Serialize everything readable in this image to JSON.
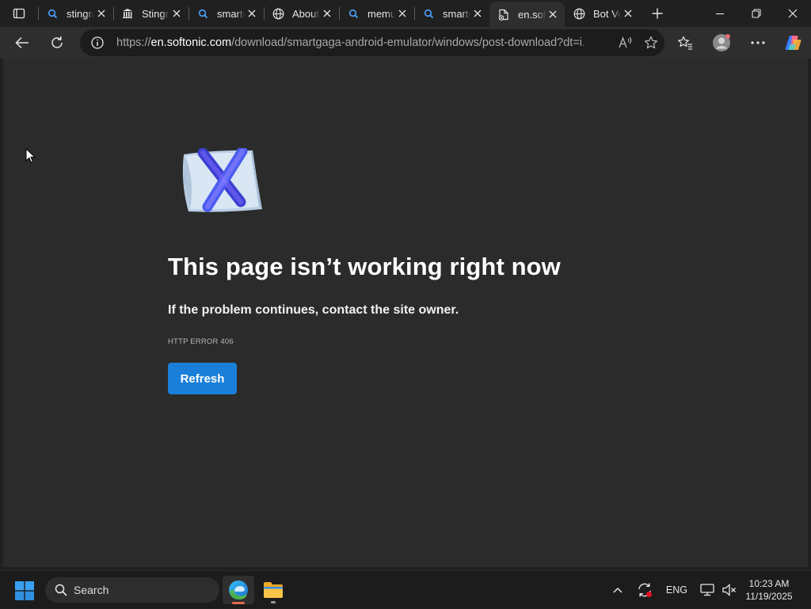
{
  "tabs": [
    {
      "label": "stingray",
      "icon": "search-icon",
      "active": false
    },
    {
      "label": "Stingray",
      "icon": "museum-icon",
      "active": false
    },
    {
      "label": "smartgaga",
      "icon": "search-icon",
      "active": false
    },
    {
      "label": "About",
      "icon": "globe-icon",
      "active": false
    },
    {
      "label": "memu",
      "icon": "search-icon",
      "active": false
    },
    {
      "label": "smartgaga",
      "icon": "search-icon",
      "active": false
    },
    {
      "label": "en.softonic",
      "icon": "broken-page-icon",
      "active": true
    },
    {
      "label": "Bot Verification",
      "icon": "globe-icon",
      "active": false
    }
  ],
  "address_bar": {
    "url_prefix": "https://",
    "host": "en.softonic.com",
    "path": "/download/smartgaga-android-emulator/windows/post-download?dt=i..."
  },
  "error_page": {
    "title": "This page isn’t working right now",
    "subtitle": "If the problem continues, contact the site owner.",
    "code": "HTTP ERROR 406",
    "refresh_label": "Refresh"
  },
  "taskbar": {
    "search_label": "Search",
    "language": "ENG",
    "time": "10:23 AM",
    "date": "11/19/2025"
  },
  "colors": {
    "accent": "#1a7fd8",
    "page_background": "#2b2b2b",
    "chrome_background": "#202020"
  }
}
